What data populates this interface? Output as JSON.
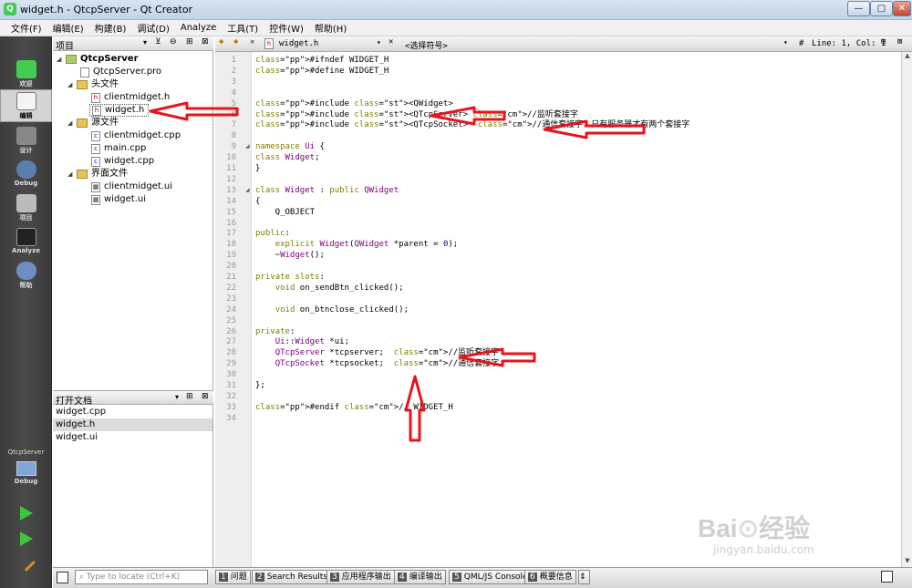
{
  "window": {
    "title": "widget.h - QtcpServer - Qt Creator",
    "min": "—",
    "max": "□",
    "close": "✕"
  },
  "menu": [
    "文件(F)",
    "编辑(E)",
    "构建(B)",
    "调试(D)",
    "Analyze",
    "工具(T)",
    "控件(W)",
    "帮助(H)"
  ],
  "modes": [
    {
      "label": "欢迎",
      "icon": "qt-logo-icon"
    },
    {
      "label": "编辑",
      "icon": "edit-icon"
    },
    {
      "label": "设计",
      "icon": "design-icon"
    },
    {
      "label": "Debug",
      "icon": "debug-icon"
    },
    {
      "label": "项目",
      "icon": "project-icon"
    },
    {
      "label": "Analyze",
      "icon": "analyze-icon"
    },
    {
      "label": "帮助",
      "icon": "help-icon"
    }
  ],
  "run_target": {
    "project": "QtcpServer",
    "config": "Debug"
  },
  "sidebar": {
    "title": "项目",
    "tree": [
      "QtcpServer",
      "QtcpServer.pro",
      "头文件",
      "clientmidget.h",
      "widget.h",
      "源文件",
      "clientmidget.cpp",
      "main.cpp",
      "widget.cpp",
      "界面文件",
      "clientmidget.ui",
      "widget.ui"
    ]
  },
  "opendocs": {
    "title": "打开文档",
    "items": [
      "widget.cpp",
      "widget.h",
      "widget.ui"
    ]
  },
  "editor": {
    "file": "widget.h",
    "symbol": "<选择符号>",
    "hash": "#",
    "position": "Line: 1, Col: 1",
    "lines": [
      "#ifndef WIDGET_H",
      "#define WIDGET_H",
      "",
      "",
      "#include <QWidget>",
      "#include <QTcpServer> //监听套接字",
      "#include <QTcpSocket>  //通信套接字，只有服务器才有两个套接字",
      "",
      "namespace Ui {",
      "class Widget;",
      "}",
      "",
      "class Widget : public QWidget",
      "{",
      "    Q_OBJECT",
      "",
      "public:",
      "    explicit Widget(QWidget *parent = 0);",
      "    ~Widget();",
      "",
      "private slots:",
      "    void on_sendBtn_clicked();",
      "",
      "    void on_btnclose_clicked();",
      "",
      "private:",
      "    Ui::Widget *ui;",
      "    QTcpServer *tcpserver;  //监听套接字",
      "    QTcpSocket *tcpsocket;  //通信套接字",
      "",
      "};",
      "",
      "#endif // WIDGET_H",
      ""
    ]
  },
  "status": {
    "locator": "Type to locate (Ctrl+K)",
    "tabs": [
      {
        "n": "1",
        "label": "问题"
      },
      {
        "n": "2",
        "label": "Search Results"
      },
      {
        "n": "3",
        "label": "应用程序输出"
      },
      {
        "n": "4",
        "label": "编译输出"
      },
      {
        "n": "5",
        "label": "QML/JS Console"
      },
      {
        "n": "6",
        "label": "概要信息"
      }
    ]
  },
  "watermark": "Baidu经验 jingyan.baidu.com",
  "colors": {
    "arrow": "#e8131b",
    "modebar": "#404040"
  }
}
